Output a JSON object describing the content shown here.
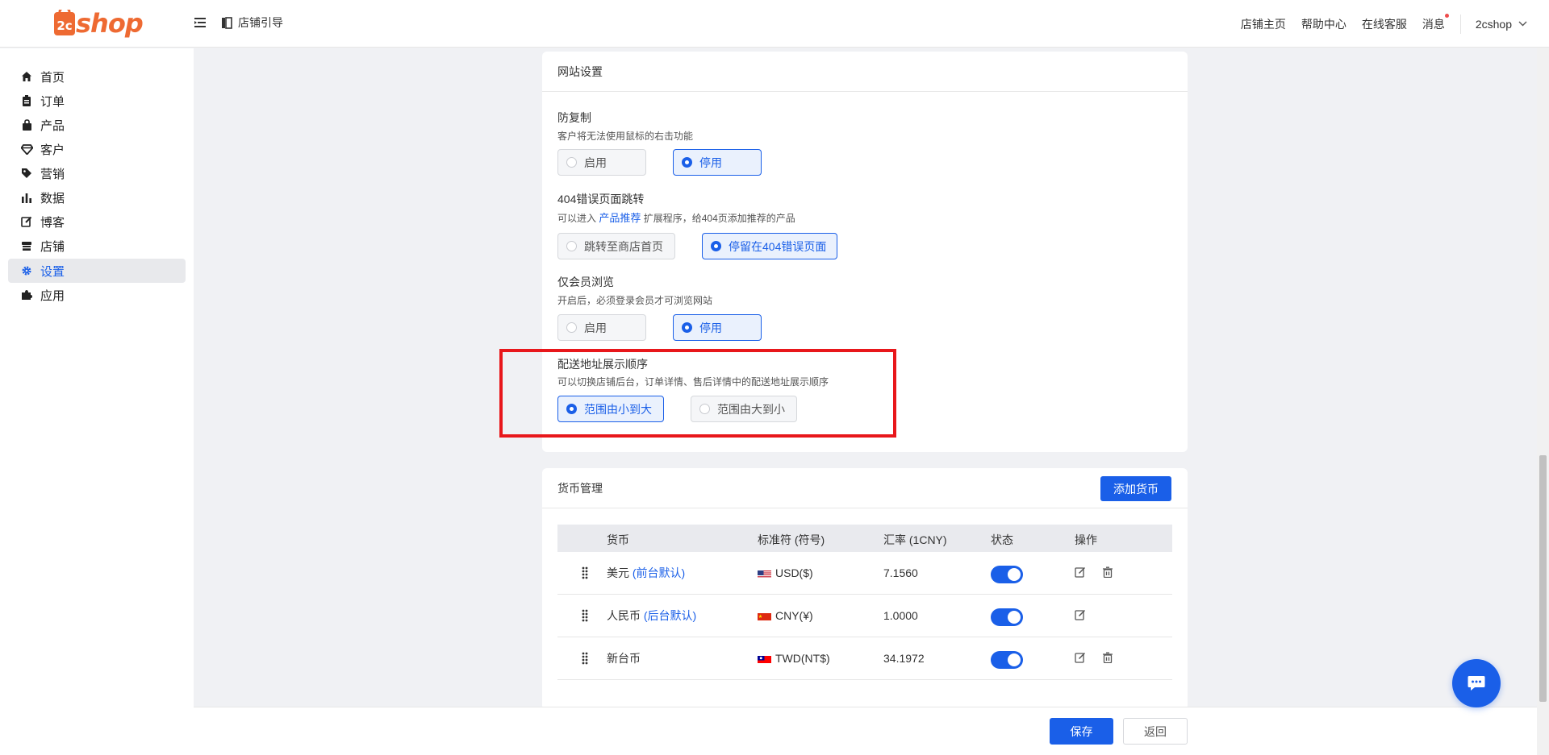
{
  "header": {
    "logo": {
      "prefix": "2c",
      "text": "shop"
    },
    "guide_label": "店铺引导",
    "links": [
      "店铺主页",
      "帮助中心",
      "在线客服",
      "消息"
    ],
    "user": "2cshop"
  },
  "sidebar": {
    "items": [
      {
        "label": "首页",
        "icon": "home-icon"
      },
      {
        "label": "订单",
        "icon": "clipboard-icon"
      },
      {
        "label": "产品",
        "icon": "bag-icon"
      },
      {
        "label": "客户",
        "icon": "gem-icon"
      },
      {
        "label": "营销",
        "icon": "tag-icon"
      },
      {
        "label": "数据",
        "icon": "bar-chart-icon"
      },
      {
        "label": "博客",
        "icon": "edit-icon"
      },
      {
        "label": "店铺",
        "icon": "store-icon"
      },
      {
        "label": "设置",
        "icon": "gear-icon",
        "active": true
      },
      {
        "label": "应用",
        "icon": "puzzle-icon"
      }
    ]
  },
  "site_settings": {
    "title": "网站设置",
    "anti_copy": {
      "title": "防复制",
      "desc": "客户将无法使用鼠标的右击功能",
      "options": [
        "启用",
        "停用"
      ],
      "selected": "停用"
    },
    "redirect_404": {
      "title": "404错误页面跳转",
      "desc_prefix": "可以进入",
      "desc_link": "产品推荐",
      "desc_suffix": "扩展程序，给404页添加推荐的产品",
      "options": [
        "跳转至商店首页",
        "停留在404错误页面"
      ],
      "selected": "停留在404错误页面"
    },
    "members_only": {
      "title": "仅会员浏览",
      "desc": "开启后，必须登录会员才可浏览网站",
      "options": [
        "启用",
        "停用"
      ],
      "selected": "停用"
    },
    "address_order": {
      "title": "配送地址展示顺序",
      "desc": "可以切换店铺后台，订单详情、售后详情中的配送地址展示顺序",
      "options": [
        "范围由小到大",
        "范围由大到小"
      ],
      "selected": "范围由小到大"
    }
  },
  "currency": {
    "title": "货币管理",
    "add_button": "添加货币",
    "columns": [
      "货币",
      "标准符 (符号)",
      "汇率 (1CNY)",
      "状态",
      "操作"
    ],
    "rows": [
      {
        "name": "美元",
        "tag": "(前台默认)",
        "flag": "us",
        "code": "USD($)",
        "rate": "7.1560",
        "enabled": true,
        "deletable": true
      },
      {
        "name": "人民币",
        "tag": "(后台默认)",
        "flag": "cn",
        "code": "CNY(¥)",
        "rate": "1.0000",
        "enabled": true,
        "deletable": false
      },
      {
        "name": "新台币",
        "tag": "",
        "flag": "tw",
        "code": "TWD(NT$)",
        "rate": "34.1972",
        "enabled": true,
        "deletable": true
      }
    ]
  },
  "footer": {
    "save": "保存",
    "back": "返回"
  },
  "colors": {
    "primary": "#1a5fe8",
    "brand": "#ee6a32",
    "highlight": "#e8171b"
  }
}
